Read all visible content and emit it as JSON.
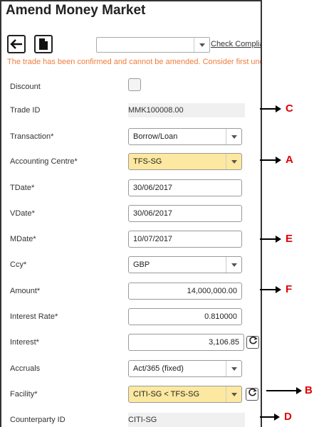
{
  "window": {
    "title": "Amend Money Market"
  },
  "toolbar": {
    "back_icon": "arrow-left-icon",
    "document_icon": "document-icon",
    "top_select_value": "",
    "check_link": "Check Complia"
  },
  "warning": "The trade has been confirmed and cannot be amended. Consider first und",
  "fields": {
    "discount": {
      "label": "Discount"
    },
    "trade_id": {
      "label": "Trade ID",
      "value": "MMK100008.00"
    },
    "transaction": {
      "label": "Transaction*",
      "value": "Borrow/Loan"
    },
    "accounting_centre": {
      "label": "Accounting Centre*",
      "value": "TFS-SG"
    },
    "tdate": {
      "label": "TDate*",
      "value": "30/06/2017"
    },
    "vdate": {
      "label": "VDate*",
      "value": "30/06/2017"
    },
    "mdate": {
      "label": "MDate*",
      "value": "10/07/2017"
    },
    "ccy": {
      "label": "Ccy*",
      "value": "GBP"
    },
    "amount": {
      "label": "Amount*",
      "value": "14,000,000.00"
    },
    "interest_rate": {
      "label": "Interest Rate*",
      "value": "0.810000"
    },
    "interest": {
      "label": "Interest*",
      "value": "3,106.85"
    },
    "accruals": {
      "label": "Accruals",
      "value": "Act/365 (fixed)"
    },
    "facility": {
      "label": "Facility*",
      "value": "CITI-SG < TFS-SG"
    },
    "counterparty_id": {
      "label": "Counterparty ID",
      "value": "CITI-SG"
    }
  },
  "callouts": {
    "c": "C",
    "a": "A",
    "e": "E",
    "f": "F",
    "b": "B",
    "d": "D"
  },
  "colors": {
    "highlight": "#fce8a0",
    "warning": "#f07c3c",
    "callout_letter": "#e00000"
  }
}
